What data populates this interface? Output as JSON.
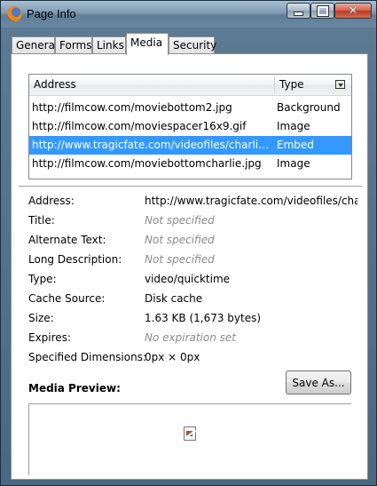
{
  "window": {
    "title": "Page Info",
    "close_glyph": "✕"
  },
  "tabs": [
    {
      "label": "General"
    },
    {
      "label": "Forms"
    },
    {
      "label": "Links"
    },
    {
      "label": "Media",
      "active": true
    },
    {
      "label": "Security"
    }
  ],
  "media_list": {
    "columns": {
      "address": "Address",
      "type": "Type"
    },
    "rows": [
      {
        "address": "http://filmcow.com/moviebottom2.jpg",
        "type": "Background"
      },
      {
        "address": "http://filmcow.com/moviespacer16x9.gif",
        "type": "Image"
      },
      {
        "address": "http://www.tragicfate.com/videofiles/charlietheu...",
        "type": "Embed",
        "selected": true
      },
      {
        "address": "http://filmcow.com/moviebottomcharlie.jpg",
        "type": "Image"
      }
    ]
  },
  "details": {
    "address": {
      "label": "Address:",
      "value": "http://www.tragicfate.com/videofiles/charlie"
    },
    "title": {
      "label": "Title:",
      "value": "Not specified"
    },
    "alt_text": {
      "label": "Alternate Text:",
      "value": "Not specified"
    },
    "long_desc": {
      "label": "Long Description:",
      "value": "Not specified"
    },
    "type": {
      "label": "Type:",
      "value": "video/quicktime"
    },
    "cache_source": {
      "label": "Cache Source:",
      "value": "Disk cache"
    },
    "size": {
      "label": "Size:",
      "value": "1.63 KB (1,673 bytes)"
    },
    "expires": {
      "label": "Expires:",
      "value": "No expiration set"
    },
    "dimensions": {
      "label": "Specified Dimensions:",
      "value": "0px × 0px"
    }
  },
  "preview": {
    "label": "Media Preview:",
    "save_label": "Save As..."
  },
  "colors": {
    "selection": "#3399ff",
    "muted_text": "#8a8a8a"
  }
}
